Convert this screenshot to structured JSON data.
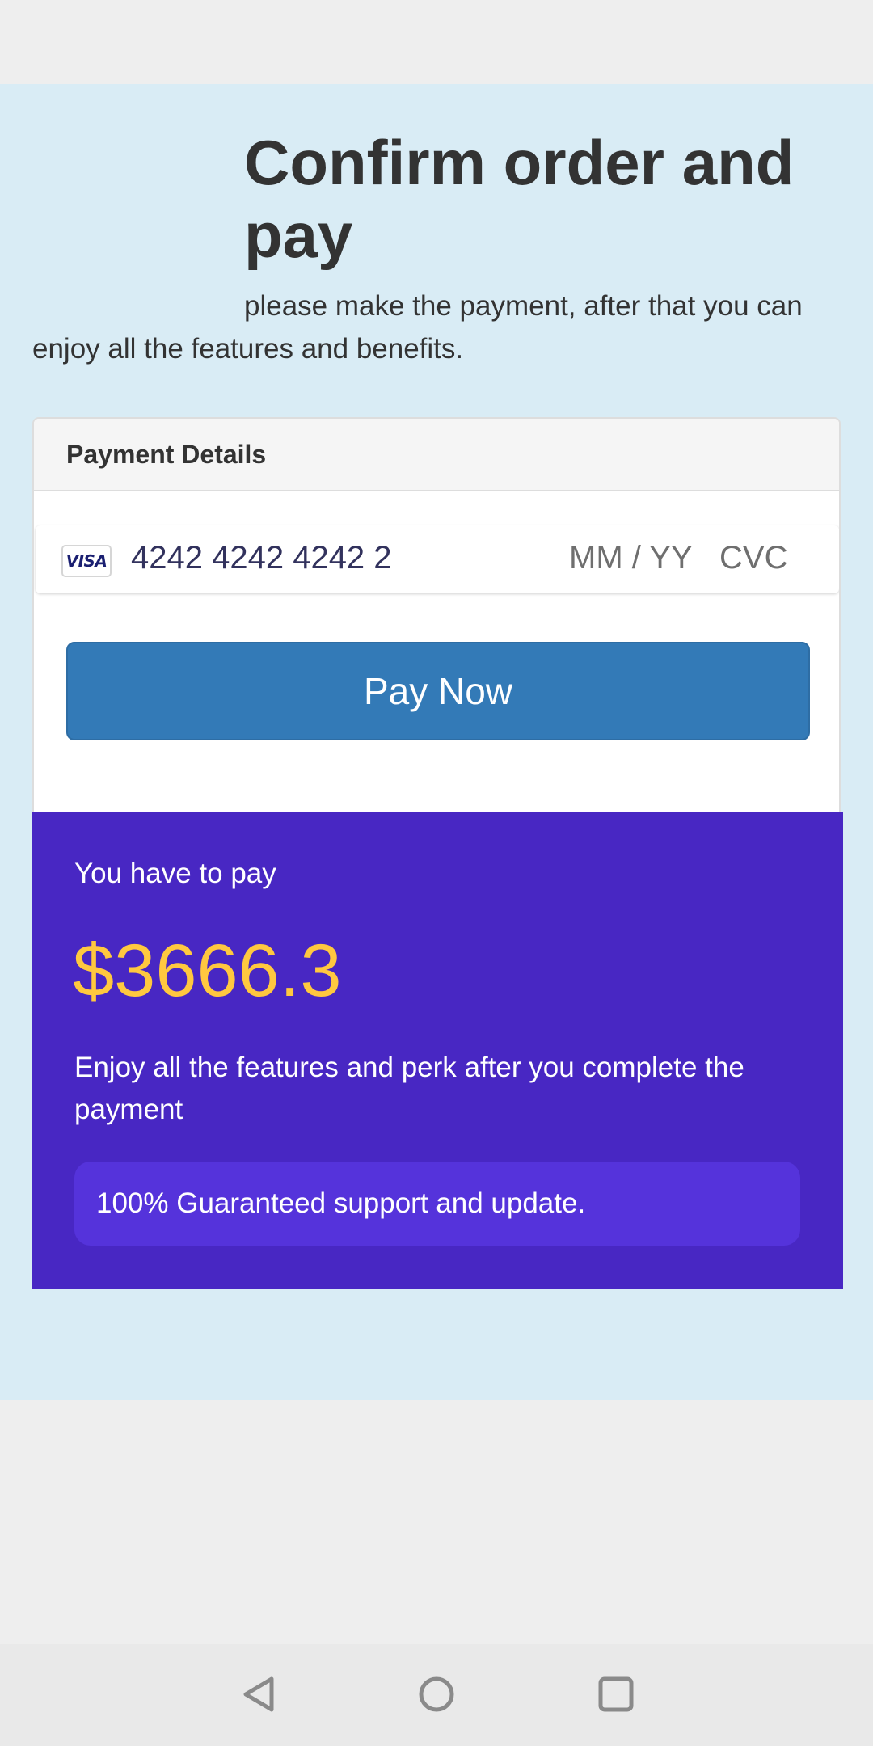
{
  "header": {
    "title": "Confirm order and pay",
    "subtitle": "please make the payment, after that you can enjoy all the features and benefits."
  },
  "payment_panel": {
    "heading": "Payment Details",
    "card": {
      "brand": "VISA",
      "brand_icon": "visa-card-icon",
      "number_value": "4242 4242 4242 2",
      "expiry_placeholder": "MM / YY",
      "cvc_placeholder": "CVC"
    },
    "pay_button_label": "Pay Now"
  },
  "summary": {
    "label": "You have to pay",
    "amount": "$3666.3",
    "note": "Enjoy all the features and perk after you complete the payment",
    "guarantee": "100% Guaranteed support and update."
  },
  "navigation": {
    "back_icon": "back-triangle-icon",
    "home_icon": "home-circle-icon",
    "recents_icon": "recents-square-icon"
  },
  "colors": {
    "background": "#d9ecf5",
    "primary_button": "#337ab7",
    "summary_background": "#4827c3",
    "badge_background": "#5533db",
    "amount": "#ffc83f",
    "heading_text": "#333333"
  }
}
